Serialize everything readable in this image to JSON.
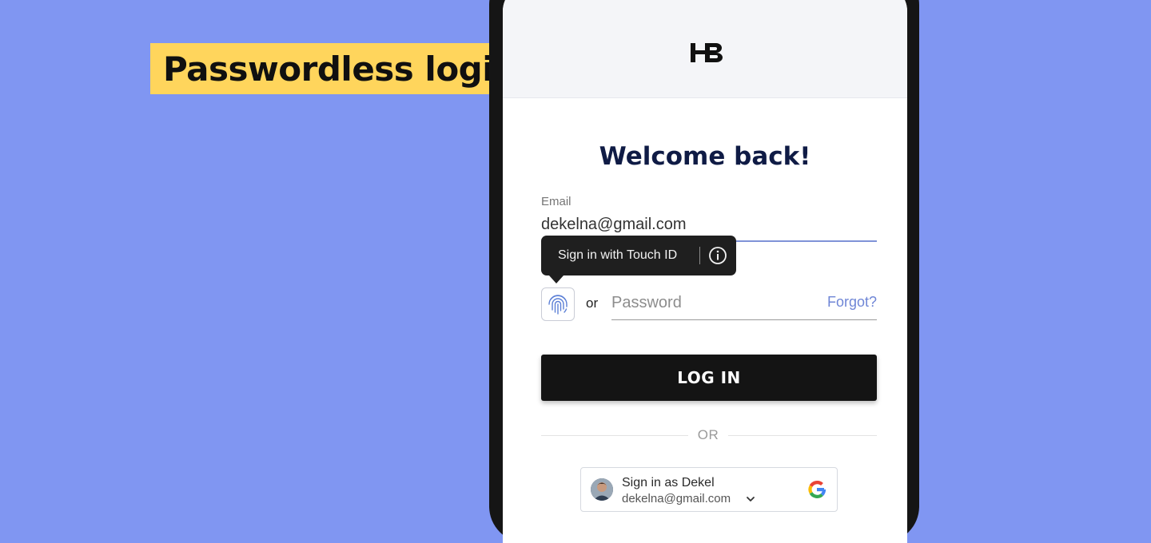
{
  "banner": {
    "text": "Passwordless login"
  },
  "app": {
    "heading": "Welcome back!",
    "email": {
      "label": "Email",
      "value": "dekelna@gmail.com"
    },
    "tooltip": {
      "text": "Sign in with Touch ID"
    },
    "or_inline": "or",
    "password": {
      "placeholder": "Password",
      "value": ""
    },
    "forgot_label": "Forgot?",
    "login_label": "LOG IN",
    "divider_text": "OR",
    "google": {
      "title": "Sign in as Dekel",
      "email": "dekelna@gmail.com"
    }
  },
  "colors": {
    "background": "#8096f2",
    "banner": "#ffd55c",
    "heading": "#0f1b45",
    "accent": "#6f86d6",
    "button": "#141414"
  },
  "icons": [
    "hb-logo",
    "info-icon",
    "fingerprint-icon",
    "chevron-down-icon",
    "google-icon",
    "avatar"
  ]
}
